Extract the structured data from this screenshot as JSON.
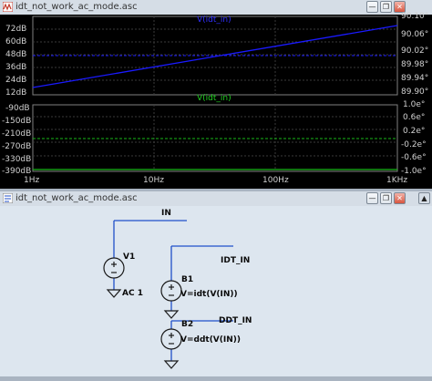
{
  "plot_window": {
    "title": "idt_not_work_ac_mode.asc",
    "upper_pane": {
      "trace_label": "V(idt_in)",
      "left_ticks": [
        "72dB",
        "60dB",
        "48dB",
        "36dB",
        "24dB",
        "12dB"
      ],
      "right_ticks": [
        "90.10°",
        "90.06°",
        "90.02°",
        "89.98°",
        "89.94°",
        "89.90°"
      ]
    },
    "lower_pane": {
      "trace_label": "V(idt_in)",
      "left_ticks": [
        "-90dB",
        "-150dB",
        "-210dB",
        "-270dB",
        "-330dB",
        "-390dB"
      ],
      "right_ticks": [
        "1.0e°",
        "0.6e°",
        "0.2e°",
        "-0.2e°",
        "-0.6e°",
        "-1.0e°"
      ]
    },
    "x_ticks": [
      "1Hz",
      "10Hz",
      "100Hz",
      "1KHz"
    ]
  },
  "schematic_window": {
    "title": "idt_not_work_ac_mode.asc",
    "labels": {
      "net_in": "IN",
      "v1": "V1",
      "ac": "AC 1",
      "b1": "B1",
      "net_idt": "IDT_IN",
      "b1_expr": "V=idt(V(IN))",
      "b2": "B2",
      "net_ddt": "DDT_IN",
      "b2_expr": "V=ddt(V(IN))"
    }
  },
  "colors": {
    "magnitude_trace": "#1a1aff",
    "phase_trace": "#18b818",
    "grid": "#3a3a3a",
    "wire": "#1f4fc9"
  }
}
